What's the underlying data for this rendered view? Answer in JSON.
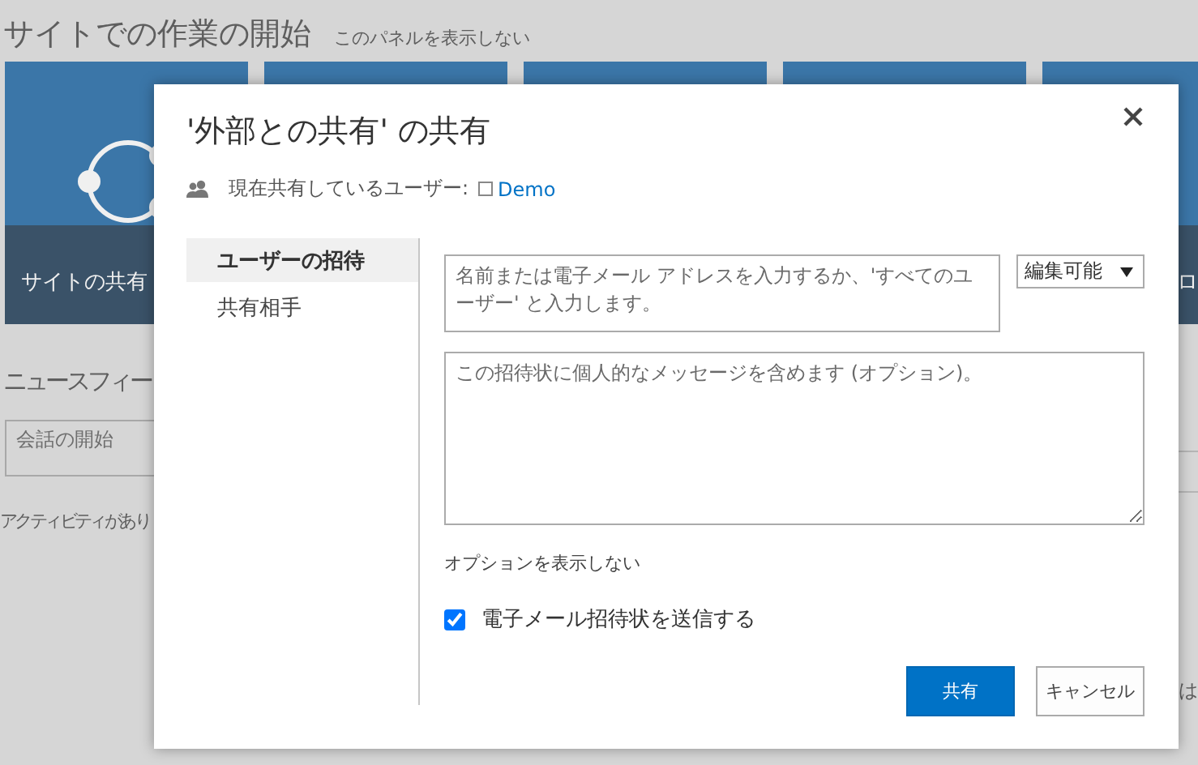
{
  "page": {
    "title": "サイトでの作業の開始",
    "hide_panel_link": "このパネルを表示しない",
    "tiles": [
      {
        "kind": "share",
        "label": "サイトの共有"
      },
      {
        "kind": "blank"
      },
      {
        "kind": "blank"
      },
      {
        "kind": "blank"
      },
      {
        "kind": "edge",
        "label": "ロ"
      }
    ],
    "newsfeed_heading": "ニュースフィー",
    "conversation_placeholder": "会話の開始",
    "activity_text": "アクティビティがあり",
    "edge_text": "は"
  },
  "dialog": {
    "title": "'外部との共有' の共有",
    "shared_with_label": "現在共有しているユーザー:",
    "shared_with_user": "Demo",
    "nav": [
      {
        "label": "ユーザーの招待",
        "selected": true
      },
      {
        "label": "共有相手",
        "selected": false
      }
    ],
    "people_placeholder": "名前または電子メール アドレスを入力するか、'すべてのユーザー' と入力します。",
    "permission": "編集可能",
    "message_placeholder": "この招待状に個人的なメッセージを含めます (オプション)。",
    "options_link": "オプションを表示しない",
    "send_email": {
      "label": "電子メール招待状を送信する",
      "checked": true
    },
    "buttons": [
      {
        "kind": "primary",
        "label": "共有"
      },
      {
        "kind": "secondary",
        "label": "キャンセル"
      }
    ]
  }
}
